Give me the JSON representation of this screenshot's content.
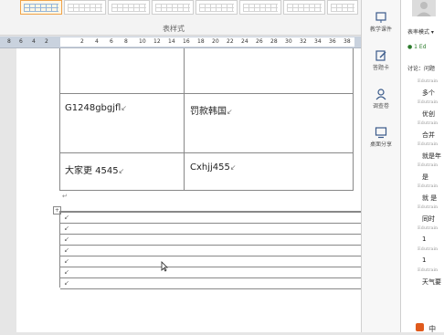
{
  "ribbon": {
    "group_label": "表样式"
  },
  "ruler": {
    "numbers": [
      "8",
      "6",
      "4",
      "2",
      "2",
      "4",
      "6",
      "8",
      "10",
      "12",
      "14",
      "16",
      "18",
      "20",
      "22",
      "24",
      "26",
      "28",
      "30",
      "32",
      "34",
      "36",
      "38"
    ]
  },
  "table1": {
    "rows": [
      {
        "left": "G1248gbgjfl",
        "right": "罚款韩国"
      },
      {
        "left": "大家更 4545",
        "right": "Cxhjj455"
      }
    ]
  },
  "marks": {
    "cell_end": "↙",
    "para": "↵",
    "row": "↙"
  },
  "toolbar": {
    "items": [
      {
        "label": "教学课件",
        "icon": "courseware-icon"
      },
      {
        "label": "答题卡",
        "icon": "answer-card-icon"
      },
      {
        "label": "调查卷",
        "icon": "survey-icon"
      },
      {
        "label": "桌面分享",
        "icon": "screen-share-icon"
      }
    ]
  },
  "chat": {
    "mode_label": "表率模式 ▾",
    "name_fragment": "1 Ed",
    "topic": "讨论：问题",
    "messages": [
      {
        "id": "Edutrain",
        "text": ""
      },
      {
        "id": "",
        "text": "多个"
      },
      {
        "id": "Edutrain",
        "text": ""
      },
      {
        "id": "",
        "text": "优创"
      },
      {
        "id": "Edutrain",
        "text": ""
      },
      {
        "id": "",
        "text": "合并"
      },
      {
        "id": "Edutrain",
        "text": ""
      },
      {
        "id": "",
        "text": "就是年"
      },
      {
        "id": "Edutrain",
        "text": ""
      },
      {
        "id": "",
        "text": "是"
      },
      {
        "id": "Edutrain",
        "text": ""
      },
      {
        "id": "",
        "text": "就 是"
      },
      {
        "id": "Edutrain",
        "text": ""
      },
      {
        "id": "",
        "text": "同时"
      },
      {
        "id": "Edutrain",
        "text": ""
      },
      {
        "id": "",
        "text": "1"
      },
      {
        "id": "Edutrain",
        "text": ""
      },
      {
        "id": "",
        "text": "1"
      },
      {
        "id": "Edutrain",
        "text": ""
      },
      {
        "id": "",
        "text": "天气要"
      }
    ],
    "footer": "中"
  }
}
